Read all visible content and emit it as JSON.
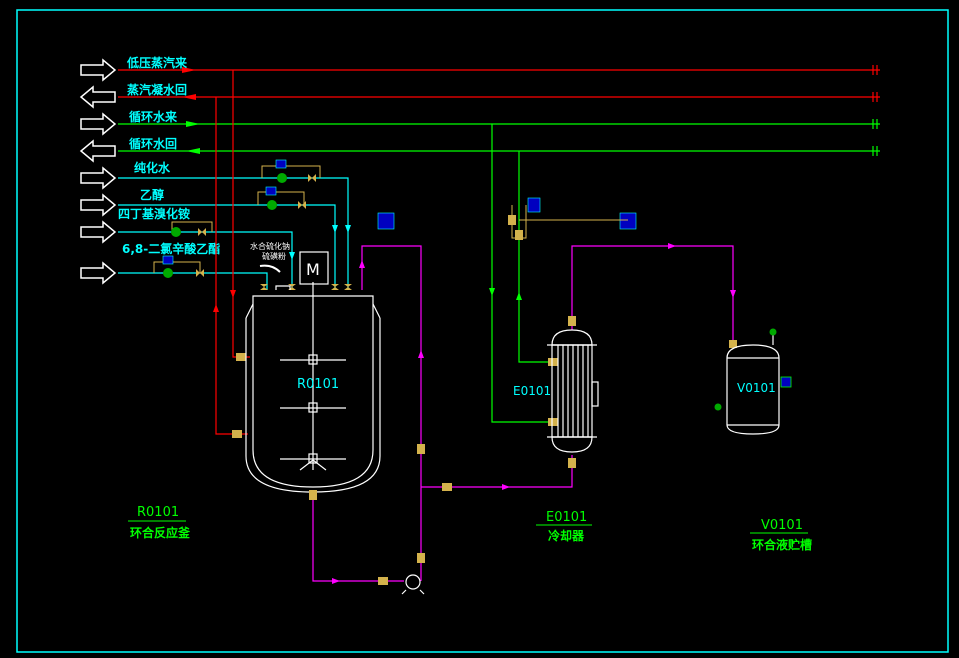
{
  "colors": {
    "background": "#000000",
    "frame": "#00ffff",
    "steam": "#ff0000",
    "cooling_water": "#00ff00",
    "feed": "#00ffff",
    "process": "#ff00ff",
    "equipment": "#ffffff",
    "valve": "#d4b24c",
    "instrument": "#0000c0",
    "label_cyan": "#00ffff",
    "label_green": "#00ff00"
  },
  "utility_lines": [
    {
      "label": "低压蒸汽来",
      "direction": "in",
      "color": "#ff0000"
    },
    {
      "label": "蒸汽凝水回",
      "direction": "out",
      "color": "#ff0000"
    },
    {
      "label": "循环水来",
      "direction": "in",
      "color": "#00ff00"
    },
    {
      "label": "循环水回",
      "direction": "out",
      "color": "#00ff00"
    }
  ],
  "feed_lines": [
    {
      "label": "纯化水",
      "direction": "in"
    },
    {
      "label": "乙醇",
      "direction": "in"
    },
    {
      "label": "四丁基溴化铵",
      "direction": "in"
    },
    {
      "label": "6,8-二氯辛酸乙酯",
      "direction": "in"
    }
  ],
  "solid_feed_label_line1": "水合硫化钠",
  "solid_feed_label_line2": "硫磺粉",
  "motor_label": "M",
  "equipment": {
    "reactor": {
      "tag": "R0101",
      "name": "环合反应釜"
    },
    "condenser": {
      "tag": "E0101",
      "name": "冷却器"
    },
    "tank": {
      "tag": "V0101",
      "name": "环合液贮槽"
    }
  }
}
